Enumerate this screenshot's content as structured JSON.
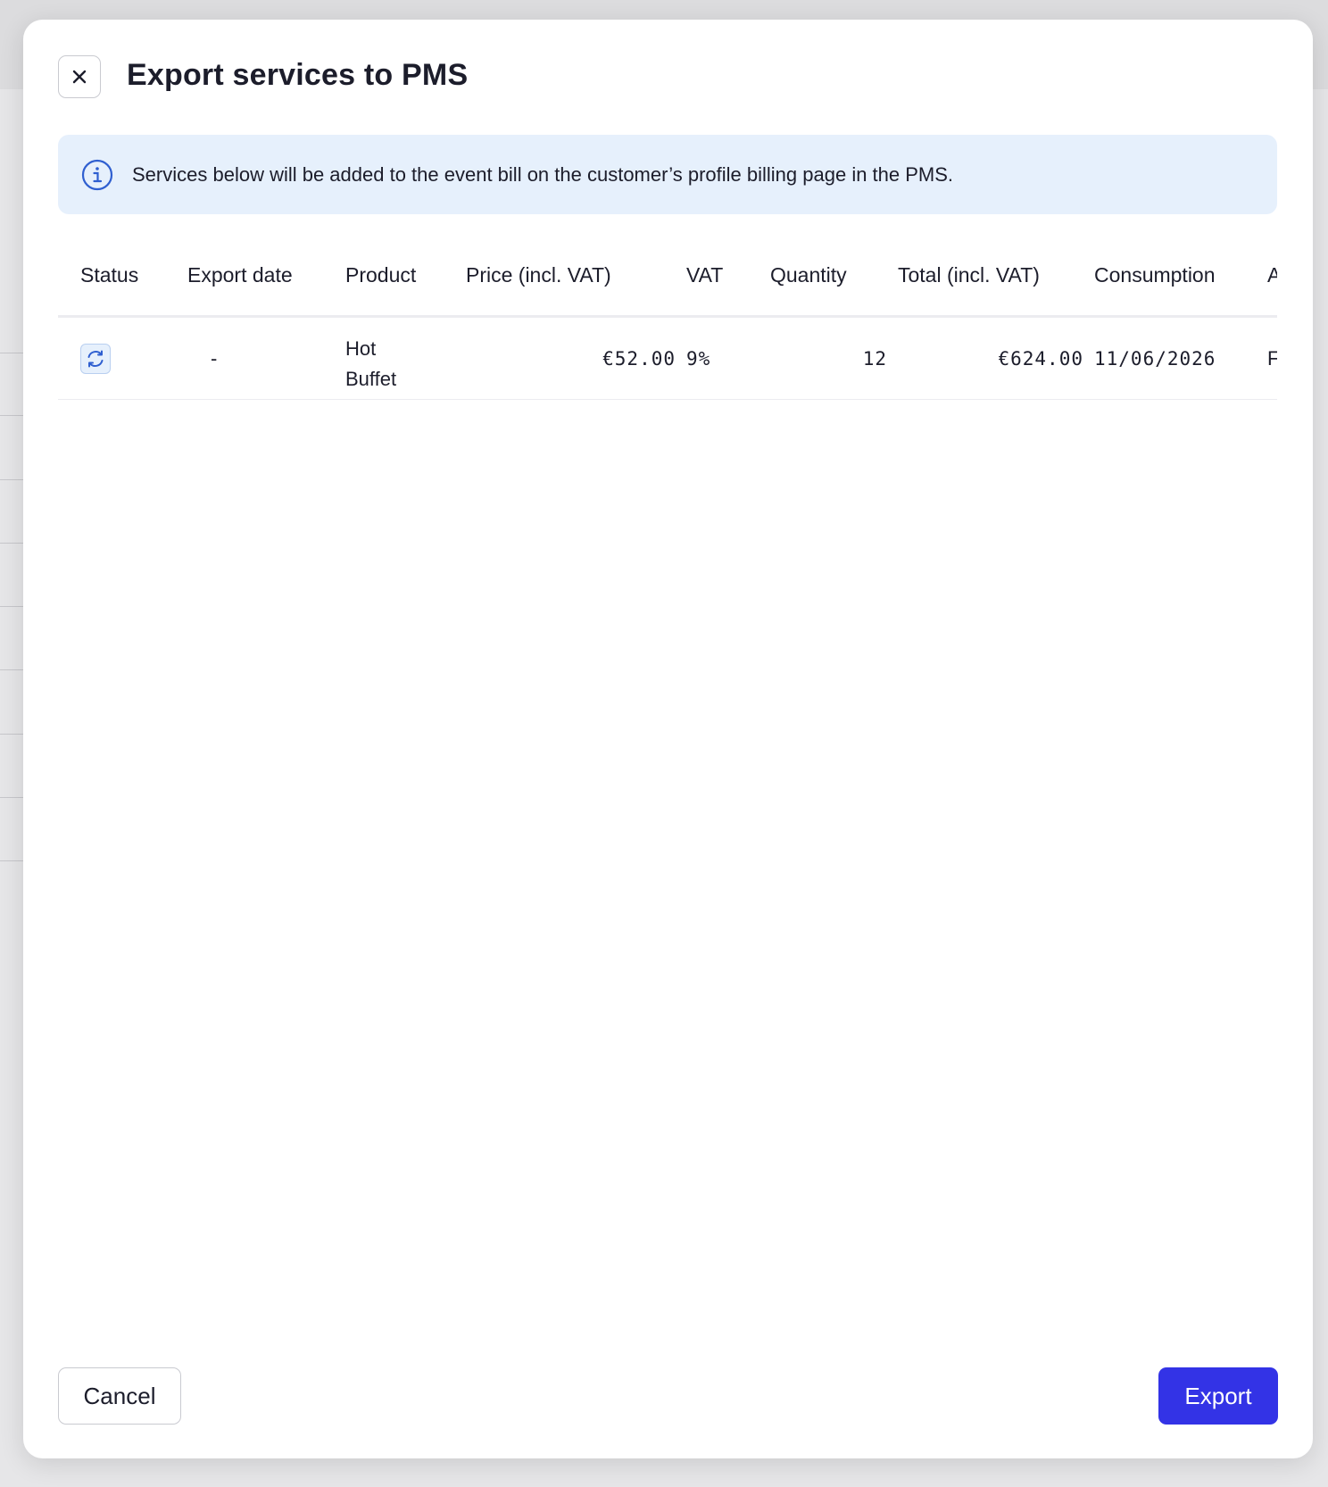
{
  "modal": {
    "title": "Export services to PMS",
    "info_text": "Services below will be added to the event bill on the customer’s profile billing page in the PMS."
  },
  "table": {
    "columns": {
      "status": "Status",
      "export_date": "Export date",
      "product": "Product",
      "price": "Price (incl. VAT)",
      "vat": "VAT",
      "quantity": "Quantity",
      "total": "Total (incl. VAT)",
      "consumption": "Consumption",
      "account": "Acc"
    },
    "rows": [
      {
        "status_icon": "sync-icon",
        "export_date": "-",
        "product": "Hot Buffet",
        "price": "€52.00",
        "vat": "9%",
        "quantity": "12",
        "total": "€624.00",
        "consumption": "11/06/2026",
        "account": "Foo"
      }
    ]
  },
  "footer": {
    "cancel_label": "Cancel",
    "export_label": "Export"
  },
  "colors": {
    "primary": "#3333e6",
    "info_bg": "#e6f0fc",
    "info_icon": "#2f5fd0"
  }
}
